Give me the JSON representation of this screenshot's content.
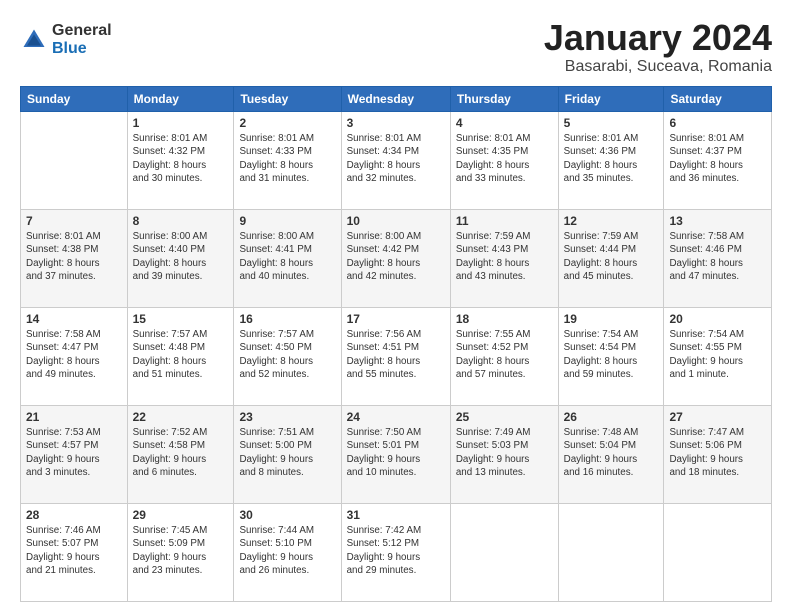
{
  "header": {
    "logo_general": "General",
    "logo_blue": "Blue",
    "title": "January 2024",
    "subtitle": "Basarabi, Suceava, Romania"
  },
  "calendar": {
    "days_of_week": [
      "Sunday",
      "Monday",
      "Tuesday",
      "Wednesday",
      "Thursday",
      "Friday",
      "Saturday"
    ],
    "weeks": [
      [
        {
          "day": "",
          "detail": ""
        },
        {
          "day": "1",
          "detail": "Sunrise: 8:01 AM\nSunset: 4:32 PM\nDaylight: 8 hours\nand 30 minutes."
        },
        {
          "day": "2",
          "detail": "Sunrise: 8:01 AM\nSunset: 4:33 PM\nDaylight: 8 hours\nand 31 minutes."
        },
        {
          "day": "3",
          "detail": "Sunrise: 8:01 AM\nSunset: 4:34 PM\nDaylight: 8 hours\nand 32 minutes."
        },
        {
          "day": "4",
          "detail": "Sunrise: 8:01 AM\nSunset: 4:35 PM\nDaylight: 8 hours\nand 33 minutes."
        },
        {
          "day": "5",
          "detail": "Sunrise: 8:01 AM\nSunset: 4:36 PM\nDaylight: 8 hours\nand 35 minutes."
        },
        {
          "day": "6",
          "detail": "Sunrise: 8:01 AM\nSunset: 4:37 PM\nDaylight: 8 hours\nand 36 minutes."
        }
      ],
      [
        {
          "day": "7",
          "detail": "Sunrise: 8:01 AM\nSunset: 4:38 PM\nDaylight: 8 hours\nand 37 minutes."
        },
        {
          "day": "8",
          "detail": "Sunrise: 8:00 AM\nSunset: 4:40 PM\nDaylight: 8 hours\nand 39 minutes."
        },
        {
          "day": "9",
          "detail": "Sunrise: 8:00 AM\nSunset: 4:41 PM\nDaylight: 8 hours\nand 40 minutes."
        },
        {
          "day": "10",
          "detail": "Sunrise: 8:00 AM\nSunset: 4:42 PM\nDaylight: 8 hours\nand 42 minutes."
        },
        {
          "day": "11",
          "detail": "Sunrise: 7:59 AM\nSunset: 4:43 PM\nDaylight: 8 hours\nand 43 minutes."
        },
        {
          "day": "12",
          "detail": "Sunrise: 7:59 AM\nSunset: 4:44 PM\nDaylight: 8 hours\nand 45 minutes."
        },
        {
          "day": "13",
          "detail": "Sunrise: 7:58 AM\nSunset: 4:46 PM\nDaylight: 8 hours\nand 47 minutes."
        }
      ],
      [
        {
          "day": "14",
          "detail": "Sunrise: 7:58 AM\nSunset: 4:47 PM\nDaylight: 8 hours\nand 49 minutes."
        },
        {
          "day": "15",
          "detail": "Sunrise: 7:57 AM\nSunset: 4:48 PM\nDaylight: 8 hours\nand 51 minutes."
        },
        {
          "day": "16",
          "detail": "Sunrise: 7:57 AM\nSunset: 4:50 PM\nDaylight: 8 hours\nand 52 minutes."
        },
        {
          "day": "17",
          "detail": "Sunrise: 7:56 AM\nSunset: 4:51 PM\nDaylight: 8 hours\nand 55 minutes."
        },
        {
          "day": "18",
          "detail": "Sunrise: 7:55 AM\nSunset: 4:52 PM\nDaylight: 8 hours\nand 57 minutes."
        },
        {
          "day": "19",
          "detail": "Sunrise: 7:54 AM\nSunset: 4:54 PM\nDaylight: 8 hours\nand 59 minutes."
        },
        {
          "day": "20",
          "detail": "Sunrise: 7:54 AM\nSunset: 4:55 PM\nDaylight: 9 hours\nand 1 minute."
        }
      ],
      [
        {
          "day": "21",
          "detail": "Sunrise: 7:53 AM\nSunset: 4:57 PM\nDaylight: 9 hours\nand 3 minutes."
        },
        {
          "day": "22",
          "detail": "Sunrise: 7:52 AM\nSunset: 4:58 PM\nDaylight: 9 hours\nand 6 minutes."
        },
        {
          "day": "23",
          "detail": "Sunrise: 7:51 AM\nSunset: 5:00 PM\nDaylight: 9 hours\nand 8 minutes."
        },
        {
          "day": "24",
          "detail": "Sunrise: 7:50 AM\nSunset: 5:01 PM\nDaylight: 9 hours\nand 10 minutes."
        },
        {
          "day": "25",
          "detail": "Sunrise: 7:49 AM\nSunset: 5:03 PM\nDaylight: 9 hours\nand 13 minutes."
        },
        {
          "day": "26",
          "detail": "Sunrise: 7:48 AM\nSunset: 5:04 PM\nDaylight: 9 hours\nand 16 minutes."
        },
        {
          "day": "27",
          "detail": "Sunrise: 7:47 AM\nSunset: 5:06 PM\nDaylight: 9 hours\nand 18 minutes."
        }
      ],
      [
        {
          "day": "28",
          "detail": "Sunrise: 7:46 AM\nSunset: 5:07 PM\nDaylight: 9 hours\nand 21 minutes."
        },
        {
          "day": "29",
          "detail": "Sunrise: 7:45 AM\nSunset: 5:09 PM\nDaylight: 9 hours\nand 23 minutes."
        },
        {
          "day": "30",
          "detail": "Sunrise: 7:44 AM\nSunset: 5:10 PM\nDaylight: 9 hours\nand 26 minutes."
        },
        {
          "day": "31",
          "detail": "Sunrise: 7:42 AM\nSunset: 5:12 PM\nDaylight: 9 hours\nand 29 minutes."
        },
        {
          "day": "",
          "detail": ""
        },
        {
          "day": "",
          "detail": ""
        },
        {
          "day": "",
          "detail": ""
        }
      ]
    ]
  }
}
